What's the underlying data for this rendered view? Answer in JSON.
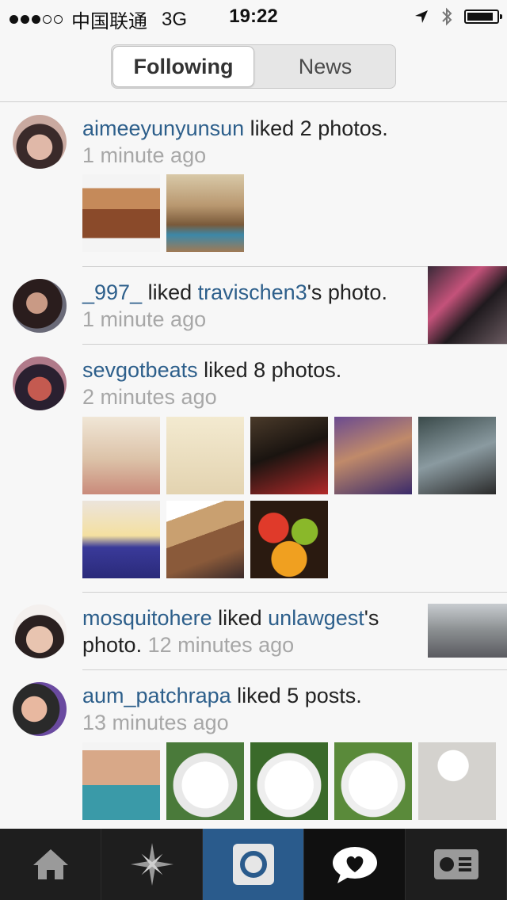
{
  "status_bar": {
    "carrier": "中国联通",
    "network": "3G",
    "time": "19:22"
  },
  "nav": {
    "tabs": [
      {
        "label": "Following",
        "active": true
      },
      {
        "label": "News",
        "active": false
      }
    ]
  },
  "feed": [
    {
      "user": "aimeeyunyunsun",
      "action": " liked 2 photos.",
      "time": "1 minute ago",
      "thumbs": 2
    },
    {
      "user": "_997_",
      "action": " liked ",
      "target": "travischen3",
      "suffix": "'s photo.",
      "time": "1 minute ago"
    },
    {
      "user": "sevgotbeats",
      "action": " liked 8 photos.",
      "time": "2 minutes ago",
      "thumbs": 8
    },
    {
      "user": "mosquitohere",
      "action": " liked ",
      "target": "unlawgest",
      "suffix": "'s",
      "line2": "photo. ",
      "time": "12 minutes ago"
    },
    {
      "user": "aum_patchrapa",
      "action": " liked 5 posts.",
      "time": "13 minutes ago",
      "thumbs": 5
    }
  ],
  "tabbar": {
    "items": [
      "home-icon",
      "explore-icon",
      "camera-icon",
      "news-icon",
      "profile-icon"
    ]
  },
  "colors": {
    "username": "#2d5f8b",
    "timestamp": "#a7a7a7",
    "tabbar_active": "#2a5b8c"
  }
}
